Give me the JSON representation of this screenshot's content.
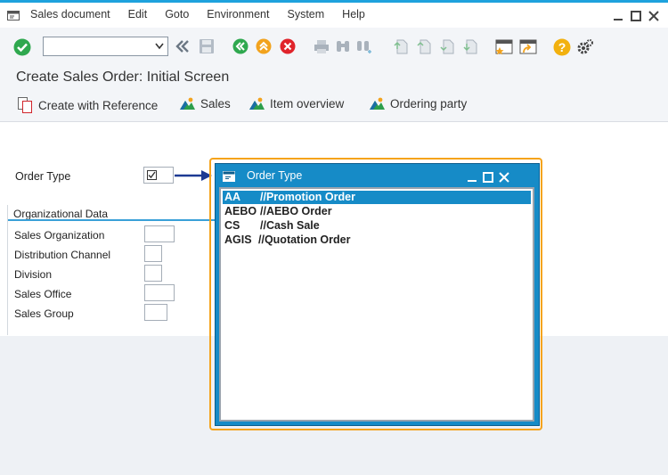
{
  "menubar": {
    "items": [
      "Sales document",
      "Edit",
      "Goto",
      "Environment",
      "System",
      "Help"
    ]
  },
  "screen": {
    "title": "Create Sales Order: Initial Screen"
  },
  "app_toolbar": {
    "create_with_reference": "Create with Reference",
    "sales": "Sales",
    "item_overview": "Item overview",
    "ordering_party": "Ordering party"
  },
  "form": {
    "order_type_label": "Order Type",
    "org_data_title": "Organizational Data",
    "fields": [
      {
        "label": "Sales Organization"
      },
      {
        "label": "Distribution Channel"
      },
      {
        "label": "Division"
      },
      {
        "label": "Sales Office"
      },
      {
        "label": "Sales Group"
      }
    ]
  },
  "popup": {
    "title": "Order Type",
    "items": [
      {
        "code": "AA",
        "desc": "//Promotion Order",
        "selected": true
      },
      {
        "code": "AEBO",
        "desc": "//AEBO Order",
        "selected": false
      },
      {
        "code": "CS",
        "desc": "//Cash Sale",
        "selected": false
      },
      {
        "code": "AGIS",
        "desc": "//Quotation Order",
        "selected": false
      }
    ]
  },
  "colors": {
    "accent": "#1ea2dd",
    "popup_blue": "#168bc7",
    "highlight_orange": "#f5a31b",
    "ok_green": "#2fa84f",
    "cancel_red": "#e0242b",
    "exit_orange": "#f2a31e"
  },
  "icons": {
    "enter": "check-circle-icon",
    "save": "save-icon",
    "back": "back-icon",
    "exit": "exit-icon",
    "cancel": "cancel-icon",
    "help": "help-icon",
    "settings": "gear-icon"
  }
}
